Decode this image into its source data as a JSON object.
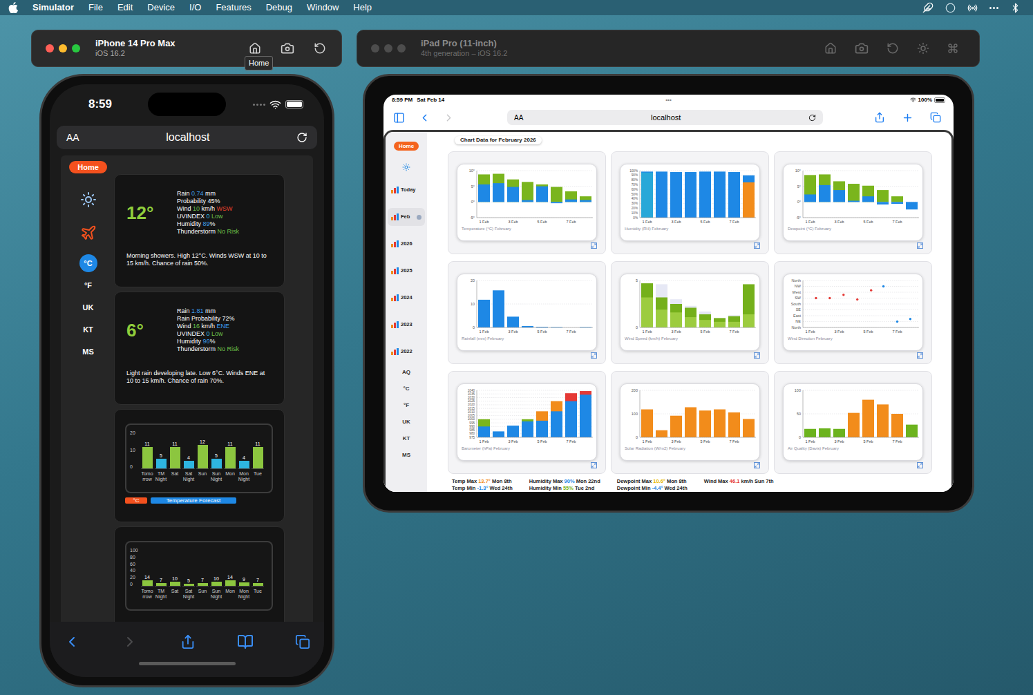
{
  "menubar": {
    "app": "Simulator",
    "items": [
      "File",
      "Edit",
      "Device",
      "I/O",
      "Features",
      "Debug",
      "Window",
      "Help"
    ]
  },
  "windows": [
    {
      "title": "iPhone 14 Pro Max",
      "subtitle": "iOS 16.2",
      "active": true,
      "tooltip": "Home"
    },
    {
      "title": "iPad Pro (11-inch)",
      "subtitle": "4th generation – iOS 16.2",
      "active": false,
      "tooltip": ""
    }
  ],
  "phone": {
    "status": {
      "time": "8:59"
    },
    "address": {
      "reader": "AA",
      "url": "localhost"
    },
    "home": "Home",
    "units": [
      {
        "label": "°C",
        "selected": true
      },
      {
        "label": "°F",
        "selected": false
      },
      {
        "label": "UK",
        "selected": false
      },
      {
        "label": "KT",
        "selected": false
      },
      {
        "label": "MS",
        "selected": false
      }
    ],
    "forecasts": [
      {
        "temp": "12°",
        "rows": [
          [
            {
              "text": "Rain "
            },
            {
              "text": "0.74",
              "color": "#3d9be9"
            },
            {
              "text": " mm"
            }
          ],
          [
            {
              "text": "Probability 45%"
            }
          ],
          [
            {
              "text": "Wind "
            },
            {
              "text": "10",
              "color": "#6cc04a"
            },
            {
              "text": " km/h "
            },
            {
              "text": "WSW",
              "color": "#e8412c"
            }
          ],
          [
            {
              "text": "UVINDEX "
            },
            {
              "text": "0",
              "color": "#35b8e0"
            },
            {
              "text": " Low",
              "color": "#6cc04a"
            }
          ],
          [
            {
              "text": "Humidity "
            },
            {
              "text": "89",
              "color": "#3d9be9"
            },
            {
              "text": "%"
            }
          ],
          [
            {
              "text": "Thunderstorm "
            },
            {
              "text": "No Risk",
              "color": "#6cc04a"
            }
          ]
        ],
        "summary": "Morning showers. High 12°C. Winds WSW at 10 to 15 km/h. Chance of rain 50%."
      },
      {
        "temp": "6°",
        "rows": [
          [
            {
              "text": "Rain "
            },
            {
              "text": "1.81",
              "color": "#3d9be9"
            },
            {
              "text": " mm"
            }
          ],
          [
            {
              "text": "Rain Probability 72%"
            }
          ],
          [
            {
              "text": "Wind "
            },
            {
              "text": "16",
              "color": "#6cc04a"
            },
            {
              "text": " km/h "
            },
            {
              "text": "ENE",
              "color": "#3d9be9"
            }
          ],
          [
            {
              "text": "UVINDEX "
            },
            {
              "text": "0",
              "color": "#35b8e0"
            },
            {
              "text": " Low",
              "color": "#6cc04a"
            }
          ],
          [
            {
              "text": "Humidity "
            },
            {
              "text": "96",
              "color": "#3d9be9"
            },
            {
              "text": "%"
            }
          ],
          [
            {
              "text": "Thunderstorm "
            },
            {
              "text": "No Risk",
              "color": "#6cc04a"
            }
          ]
        ],
        "summary": "Light rain developing late. Low 6°C. Winds ENE at 10 to 15 km/h. Chance of rain 70%."
      }
    ],
    "charts": [
      {
        "ticks": [
          "20",
          "10",
          "0"
        ],
        "max": 20,
        "values": [
          11,
          5,
          11,
          4,
          12,
          5,
          11,
          4,
          11
        ],
        "labels": [
          "11",
          "5",
          "11",
          "4",
          "12",
          "5",
          "11",
          "4",
          "11"
        ],
        "colors": [
          "#8cc63f",
          "#2eb5e0",
          "#8cc63f",
          "#2eb5e0",
          "#8cc63f",
          "#2eb5e0",
          "#8cc63f",
          "#2eb5e0",
          "#8cc63f"
        ],
        "days": [
          "Tomorrow",
          "TM Night",
          "Sat",
          "Sat Night",
          "Sun",
          "Sun Night",
          "Mon",
          "Mon Night",
          "Tue"
        ],
        "legend": [
          {
            "text": "°C",
            "color": "#f4511e"
          },
          {
            "text": "Temperature Forecast",
            "color": "#1e88e5"
          }
        ]
      },
      {
        "ticks": [
          "100",
          "80",
          "60",
          "40",
          "20",
          "0"
        ],
        "max": 100,
        "values": [
          14,
          7,
          10,
          5,
          7,
          10,
          14,
          9,
          7
        ],
        "labels": [
          "14",
          "7",
          "10",
          "5",
          "7",
          "10",
          "14",
          "9",
          "7"
        ],
        "colors": [
          "#8cc63f",
          "#8cc63f",
          "#8cc63f",
          "#8cc63f",
          "#8cc63f",
          "#8cc63f",
          "#8cc63f",
          "#8cc63f",
          "#8cc63f"
        ],
        "days": [
          "Tomorrow",
          "TM Night",
          "Sat",
          "Sat Night",
          "Sun",
          "Sun Night",
          "Mon",
          "Mon Night",
          "Tue"
        ],
        "legend": []
      }
    ]
  },
  "tablet": {
    "status": {
      "time": "8:59 PM",
      "date": "Sat Feb 14",
      "dots": "•••",
      "battery": "100%"
    },
    "address": {
      "reader": "AA",
      "url": "localhost"
    },
    "home": "Home",
    "nav": [
      {
        "label": "Today",
        "selected": false
      },
      {
        "label": "Feb",
        "selected": true
      },
      {
        "label": "2026",
        "selected": false
      },
      {
        "label": "2025",
        "selected": false
      },
      {
        "label": "2024",
        "selected": false
      },
      {
        "label": "2023",
        "selected": false
      },
      {
        "label": "2022",
        "selected": false
      }
    ],
    "units": [
      "AQ",
      "°C",
      "°F",
      "UK",
      "KT",
      "MS"
    ],
    "heading": "Chart Data for February 2026",
    "charts": [
      {
        "kind": "bars",
        "caption": "Temperature (°C) February",
        "ticks": [
          "10°",
          "5°",
          "0°",
          "-5°"
        ],
        "yMin": -5,
        "yMax": 10,
        "xLabels": [
          "1 Feb",
          "3 Feb",
          "5 Feb",
          "7 Feb"
        ],
        "series": [
          {
            "color": "#7ab51d",
            "values": [
              8.8,
              9.0,
              7.2,
              6.4,
              5.6,
              4.8,
              3.4,
              1.8
            ]
          },
          {
            "color": "#1e88e5",
            "values": [
              5.6,
              6.0,
              4.8,
              0.6,
              5.0,
              -0.4,
              0.8,
              0.6
            ]
          }
        ],
        "points": []
      },
      {
        "kind": "bars",
        "caption": "Humidity (RH) February",
        "ticks": [
          "100%",
          "90%",
          "80%",
          "70%",
          "60%",
          "50%",
          "40%",
          "30%",
          "20%",
          "10%",
          "0%"
        ],
        "yMin": 0,
        "yMax": 100,
        "xLabels": [
          "1 Feb",
          "3 Feb",
          "5 Feb",
          "7 Feb"
        ],
        "series": [
          {
            "color": "#1e88e5",
            "values": [
              98,
              98,
              97,
              97,
              98,
              98,
              97,
              90
            ]
          },
          {
            "color": "#29a8d8",
            "values": [
              96,
              0,
              0,
              0,
              0,
              0,
              0,
              0
            ]
          },
          {
            "color": "#f28c1b",
            "values": [
              0,
              0,
              0,
              0,
              0,
              0,
              0,
              75
            ]
          }
        ],
        "points": []
      },
      {
        "kind": "bars",
        "caption": "Dewpoint (°C) February",
        "ticks": [
          "10°",
          "5°",
          "0°",
          "-5°"
        ],
        "yMin": -5,
        "yMax": 10,
        "xLabels": [
          "1 Feb",
          "3 Feb",
          "5 Feb",
          "7 Feb"
        ],
        "series": [
          {
            "color": "#7ab51d",
            "values": [
              8.6,
              8.8,
              6.6,
              5.8,
              5.2,
              3.8,
              1.8,
              0
            ]
          },
          {
            "color": "#1e88e5",
            "values": [
              2.4,
              5.4,
              3.8,
              0.4,
              1.8,
              -0.8,
              -0.6,
              -2.4
            ]
          }
        ],
        "points": []
      },
      {
        "kind": "bars",
        "caption": "Rainfall (mm) February",
        "ticks": [
          "20",
          "10",
          "0"
        ],
        "yMin": 0,
        "yMax": 20,
        "xLabels": [
          "1 Feb",
          "3 Feb",
          "5 Feb",
          "7 Feb"
        ],
        "series": [
          {
            "color": "#1e88e5",
            "values": [
              11.8,
              15.8,
              4.6,
              0.6,
              0.3,
              0.2,
              0,
              0.2
            ]
          }
        ],
        "points": []
      },
      {
        "kind": "bars",
        "caption": "Wind Speed (km/h) February",
        "ticks": [
          "5",
          "0"
        ],
        "yMin": 0,
        "yMax": 5,
        "xLabels": [
          "1 Feb",
          "3 Feb",
          "5 Feb",
          "7 Feb"
        ],
        "series": [
          {
            "color": "#e6e8f5",
            "values": [
              4.6,
              4.6,
              3.0,
              2.3,
              1.7,
              1.0,
              1.3,
              0
            ]
          },
          {
            "color": "#74b01b",
            "values": [
              4.7,
              3.2,
              2.5,
              2.1,
              1.4,
              1.0,
              1.2,
              4.6
            ]
          },
          {
            "color": "#9ccc3f",
            "values": [
              3.2,
              1.9,
              1.6,
              1.1,
              0.8,
              0.6,
              0.6,
              1.4
            ]
          }
        ],
        "points": []
      },
      {
        "kind": "scatter",
        "caption": "Wind Direction February",
        "ticks": [
          "North",
          "NW",
          "West",
          "SW",
          "South",
          "SE",
          "East",
          "NE",
          "North"
        ],
        "yMin": 0,
        "yMax": 360,
        "xLabels": [
          "1 Feb",
          "3 Feb",
          "5 Feb",
          "7 Feb"
        ],
        "series": [],
        "points": [
          {
            "x": 1.4,
            "deg": 225,
            "color": "#e53935"
          },
          {
            "x": 2.35,
            "deg": 225,
            "color": "#e53935"
          },
          {
            "x": 3.3,
            "deg": 250,
            "color": "#e53935"
          },
          {
            "x": 4.25,
            "deg": 215,
            "color": "#e53935"
          },
          {
            "x": 5.2,
            "deg": 285,
            "color": "#e53935"
          },
          {
            "x": 6.05,
            "deg": 315,
            "color": "#1e88e5"
          },
          {
            "x": 7.0,
            "deg": 45,
            "color": "#1e88e5"
          },
          {
            "x": 7.9,
            "deg": 65,
            "color": "#1e88e5"
          }
        ]
      },
      {
        "kind": "bars",
        "caption": "Barometer (hPa) February",
        "ticks": [
          "1040",
          "1035",
          "1030",
          "1025",
          "1020",
          "1015",
          "1010",
          "1005",
          "1000",
          "995",
          "990",
          "985",
          "980",
          "975"
        ],
        "yMin": 975,
        "yMax": 1040,
        "xLabels": [
          "1 Feb",
          "3 Feb",
          "5 Feb",
          "7 Feb"
        ],
        "series": [
          {
            "color": "#7ab51d",
            "values": [
              1000,
              983,
              991,
              1000,
              1011,
              1025,
              1036,
              1039
            ],
            "colors": [
              "#7ab51d",
              "#1e88e5",
              "#1e88e5",
              "#7ab51d",
              "#f28c1b",
              "#f28c1b",
              "#e53935",
              "#e53935"
            ]
          },
          {
            "color": "#1e88e5",
            "values": [
              990,
              983,
              991,
              997,
              998,
              1011,
              1025,
              1034
            ]
          }
        ],
        "points": []
      },
      {
        "kind": "bars",
        "caption": "Solar Radiation (W/m2) February",
        "ticks": [
          "200",
          "100",
          "0"
        ],
        "yMin": 0,
        "yMax": 200,
        "xLabels": [
          "1 Feb",
          "3 Feb",
          "5 Feb",
          "7 Feb"
        ],
        "series": [
          {
            "color": "#f28c1b",
            "values": [
              119,
              30,
              92,
              128,
              114,
              119,
              106,
              78
            ]
          }
        ],
        "points": []
      },
      {
        "kind": "bars",
        "caption": "Air Quality (Davis) February",
        "ticks": [
          "100",
          "50",
          "0"
        ],
        "yMin": 0,
        "yMax": 100,
        "xLabels": [
          "1 Feb",
          "3 Feb",
          "5 Feb",
          "7 Feb"
        ],
        "series": [
          {
            "color": "#f28c1b",
            "values": [
              18,
              19,
              18,
              52,
              80,
              70,
              50,
              27
            ],
            "colors": [
              "#6cb31e",
              "#6cb31e",
              "#6cb31e",
              "#f28c1b",
              "#f28c1b",
              "#f28c1b",
              "#f28c1b",
              "#6cb31e"
            ]
          }
        ],
        "points": []
      }
    ],
    "stats": [
      [
        [
          {
            "text": "Temp Max "
          },
          {
            "text": "13.7°",
            "color": "#f28c1b"
          },
          {
            "text": " Mon 8th"
          }
        ],
        [
          {
            "text": "Temp Min "
          },
          {
            "text": "-1.3°",
            "color": "#1e88e5"
          },
          {
            "text": " Wed 24th"
          }
        ]
      ],
      [
        [
          {
            "text": "Humidity Max "
          },
          {
            "text": "90%",
            "color": "#1e88e5"
          },
          {
            "text": " Mon 22nd"
          }
        ],
        [
          {
            "text": "Humidity Min "
          },
          {
            "text": "55%",
            "color": "#7ab51d"
          },
          {
            "text": " Tue 2nd"
          }
        ]
      ],
      [
        [
          {
            "text": "Dewpoint Max "
          },
          {
            "text": "10.6°",
            "color": "#e6b800"
          },
          {
            "text": " Mon 8th"
          }
        ],
        [
          {
            "text": "Dewpoint Min "
          },
          {
            "text": "-4.4°",
            "color": "#1e88e5"
          },
          {
            "text": " Wed 24th"
          }
        ]
      ],
      [
        [
          {
            "text": "Wind Max "
          },
          {
            "text": "46.1",
            "color": "#e53935"
          },
          {
            "text": " km/h Sun 7th"
          }
        ]
      ]
    ]
  }
}
